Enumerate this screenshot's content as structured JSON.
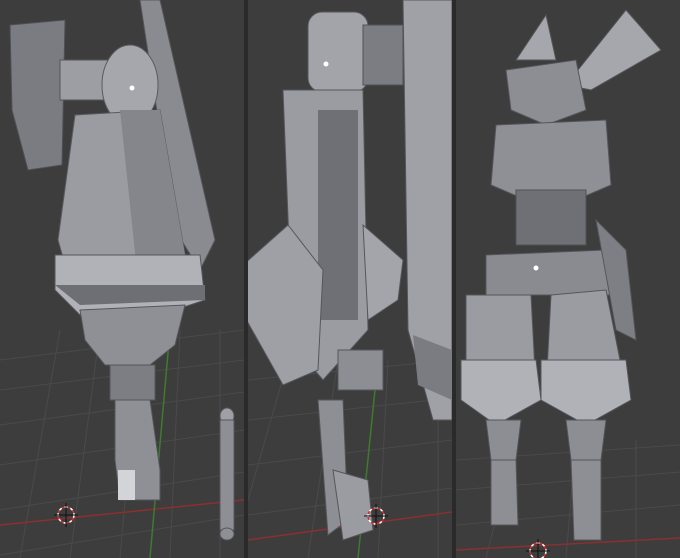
{
  "scene": {
    "description_hidden": "",
    "panels": [
      {
        "id": "front-leg-view"
      },
      {
        "id": "side-leg-view"
      },
      {
        "id": "full-body-view"
      }
    ],
    "colors": {
      "background": "#3c3c3c",
      "grid": "#4a4a4a",
      "grid_red_axis": "#8a3030",
      "grid_green_axis": "#3f7a2f",
      "mesh_light": "#a6a7ad",
      "mesh_mid": "#8f9096",
      "mesh_dark": "#6e6f75",
      "mesh_shadow": "#55565b",
      "cursor": "#ffffff"
    }
  }
}
